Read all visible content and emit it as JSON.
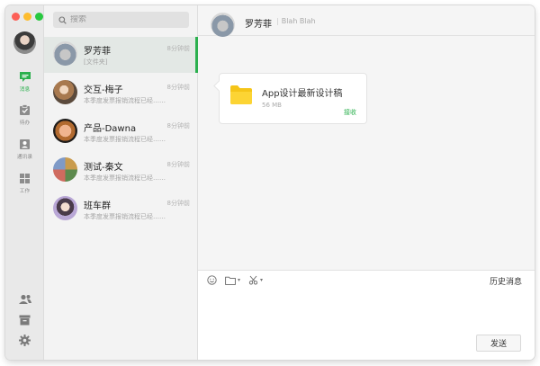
{
  "sidebar": {
    "nav": [
      {
        "label": "消息",
        "icon": "chat-icon"
      },
      {
        "label": "待办",
        "icon": "todo-icon"
      },
      {
        "label": "通讯录",
        "icon": "contacts-icon"
      },
      {
        "label": "工作",
        "icon": "apps-icon"
      }
    ],
    "bottom_icons": [
      "add-contact-icon",
      "archive-icon",
      "settings-icon"
    ],
    "accent": "#2bb04e"
  },
  "search": {
    "placeholder": "搜索"
  },
  "chats": [
    {
      "name": "罗芳菲",
      "time": "8分钟前",
      "preview": "[文件夹]",
      "selected": true
    },
    {
      "name": "交互-梅子",
      "time": "8分钟前",
      "preview": "本季度发票报销流程已经……"
    },
    {
      "name": "产品-Dawna",
      "time": "8分钟前",
      "preview": "本季度发票报销流程已经……"
    },
    {
      "name": "测试-秦文",
      "time": "8分钟前",
      "preview": "本季度发票报销流程已经……"
    },
    {
      "name": "班车群",
      "time": "8分钟前",
      "preview": "本季度发票报销流程已经……"
    }
  ],
  "conversation": {
    "name": "罗芳菲",
    "status": "Blah Blah",
    "message": {
      "title": "App设计最新设计稿",
      "size": "56 MB",
      "action": "接收"
    }
  },
  "composer": {
    "tools": [
      "emoji-icon",
      "folder-icon",
      "scissors-icon"
    ],
    "history_label": "历史消息",
    "send_label": "发送"
  }
}
